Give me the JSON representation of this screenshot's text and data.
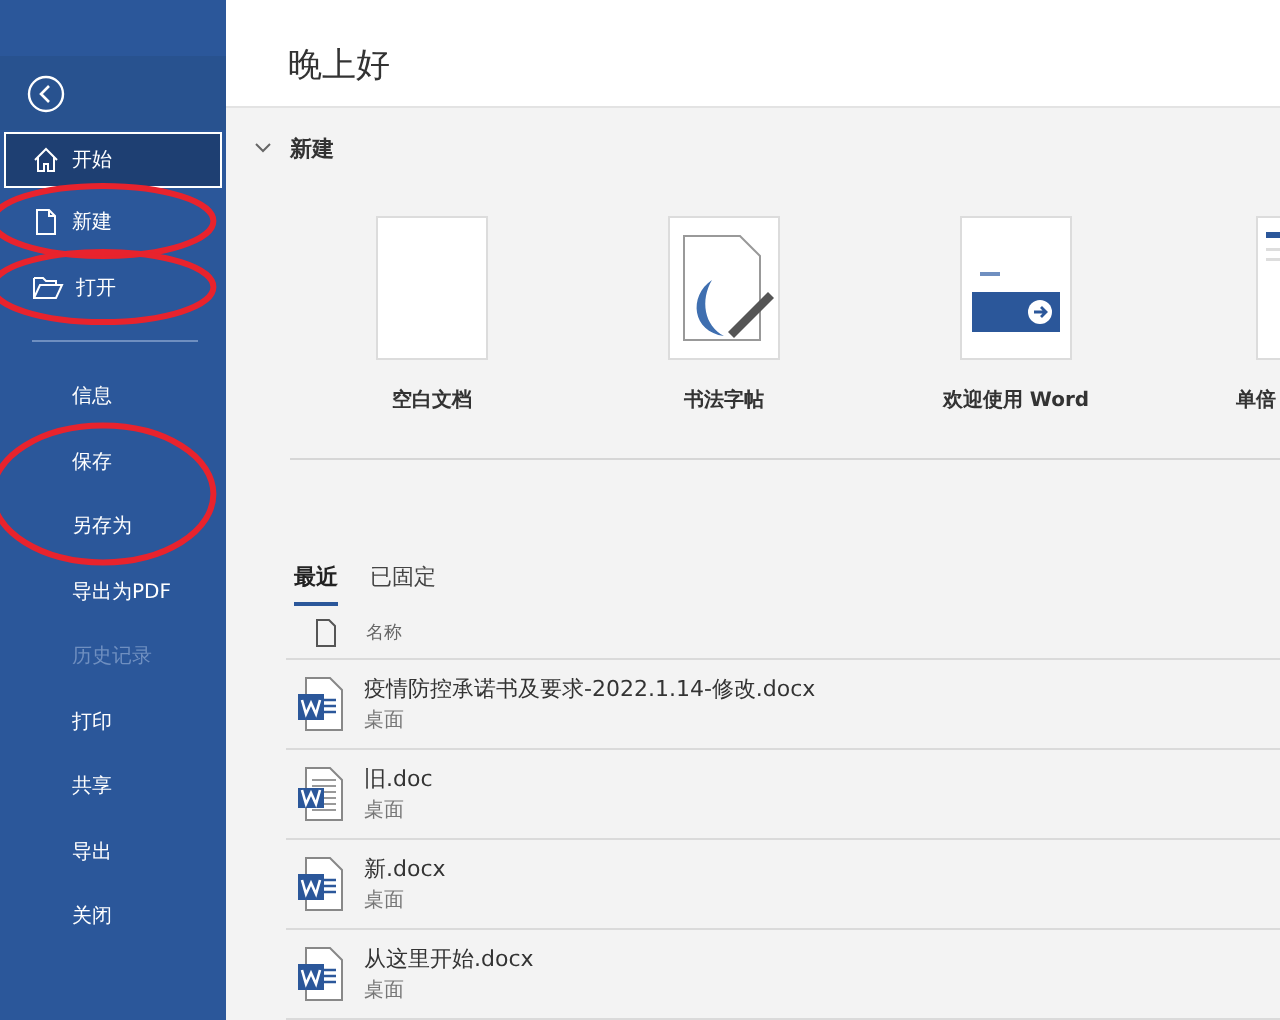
{
  "sidebar": {
    "items": [
      {
        "label": "开始",
        "kind": "home",
        "selected": true,
        "disabled": false,
        "circled": false
      },
      {
        "label": "新建",
        "kind": "file",
        "selected": false,
        "disabled": false,
        "circled": true,
        "circle_spans_next": false
      },
      {
        "label": "打开",
        "kind": "folder",
        "selected": false,
        "disabled": false,
        "circled": true,
        "circle_spans_next": false
      },
      {
        "kind": "divider"
      },
      {
        "label": "信息",
        "selected": false,
        "disabled": false,
        "circled": false
      },
      {
        "label": "保存",
        "selected": false,
        "disabled": false,
        "circled": true,
        "circle_spans_next": true
      },
      {
        "label": "另存为",
        "selected": false,
        "disabled": false,
        "circled": false
      },
      {
        "label": "导出为PDF",
        "selected": false,
        "disabled": false,
        "circled": false
      },
      {
        "label": "历史记录",
        "selected": false,
        "disabled": true,
        "circled": false
      },
      {
        "label": "打印",
        "selected": false,
        "disabled": false,
        "circled": false
      },
      {
        "label": "共享",
        "selected": false,
        "disabled": false,
        "circled": false
      },
      {
        "label": "导出",
        "selected": false,
        "disabled": false,
        "circled": false
      },
      {
        "label": "关闭",
        "selected": false,
        "disabled": false,
        "circled": false
      }
    ]
  },
  "greeting": "晚上好",
  "new_section": {
    "title": "新建",
    "expanded": true,
    "templates": [
      {
        "label": "空白文档",
        "kind": "blank"
      },
      {
        "label": "书法字帖",
        "kind": "calligraphy"
      },
      {
        "label": "欢迎使用 Word",
        "kind": "welcome"
      },
      {
        "label": "单倍",
        "kind": "cut"
      }
    ]
  },
  "tabs": [
    {
      "label": "最近",
      "selected": true
    },
    {
      "label": "已固定",
      "selected": false
    }
  ],
  "files": {
    "column": "名称",
    "rows": [
      {
        "name": "疫情防控承诺书及要求-2022.1.14-修改.docx",
        "location": "桌面",
        "kind": "docx"
      },
      {
        "name": "旧.doc",
        "location": "桌面",
        "kind": "doc"
      },
      {
        "name": "新.docx",
        "location": "桌面",
        "kind": "docx"
      },
      {
        "name": "从这里开始.docx",
        "location": "桌面",
        "kind": "docx"
      }
    ]
  }
}
